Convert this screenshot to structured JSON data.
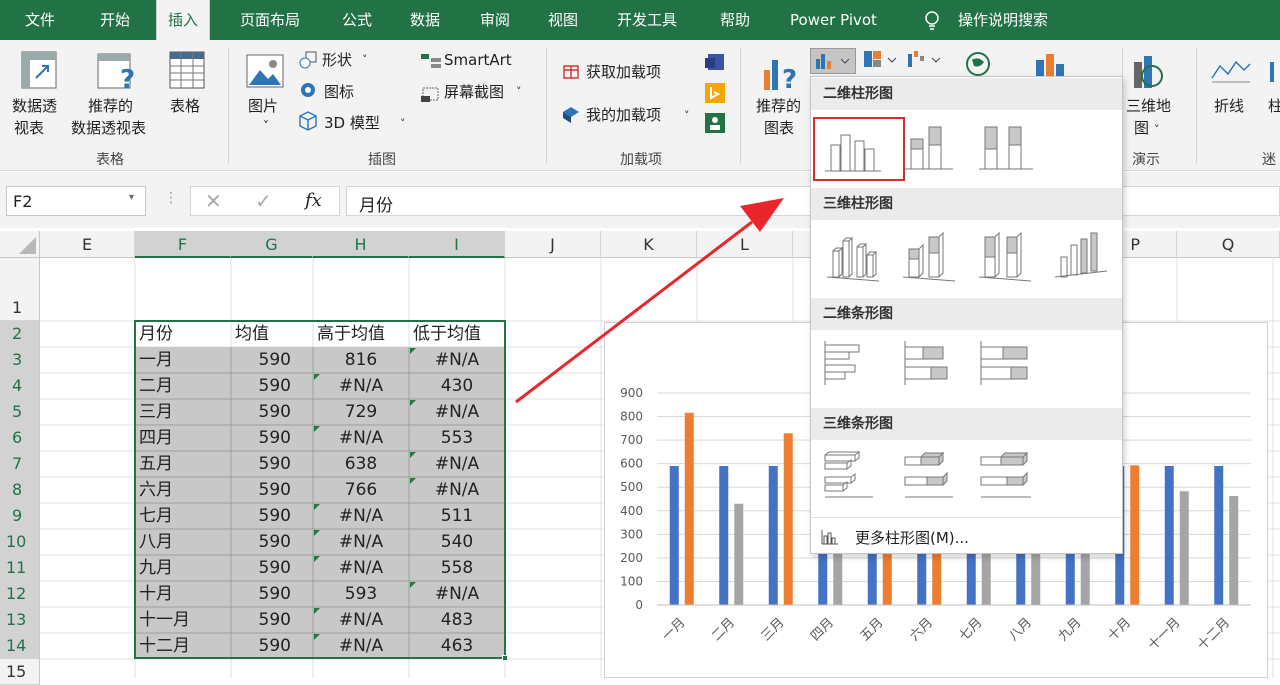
{
  "tabs": [
    "文件",
    "开始",
    "插入",
    "页面布局",
    "公式",
    "数据",
    "审阅",
    "视图",
    "开发工具",
    "帮助",
    "Power Pivot",
    "操作说明搜索"
  ],
  "ribbon": {
    "pivot": "数据透视表",
    "pivot_line1": "数据透",
    "pivot_line2": "视表",
    "recommended_pivot_1": "推荐的",
    "recommended_pivot_2": "数据透视表",
    "table": "表格",
    "picture": "图片",
    "shapes": "形状",
    "icons": "图标",
    "model3d": "3D 模型",
    "smartart": "SmartArt",
    "screenshot": "屏幕截图",
    "get_addins": "获取加载项",
    "my_addins": "我的加载项",
    "rec_chart_1": "推荐的",
    "rec_chart_2": "图表",
    "map3d_1": "三维地",
    "map3d_2": "图",
    "line": "折线",
    "col": "柱",
    "groups": {
      "tables": "表格",
      "illustrations": "插图",
      "addins": "加载项",
      "tours": "演示",
      "spark": "迷"
    }
  },
  "formula": {
    "name_box": "F2",
    "content": "月份"
  },
  "columns": [
    "E",
    "F",
    "G",
    "H",
    "I",
    "J",
    "K",
    "L",
    "P",
    "Q"
  ],
  "rows": [
    "1",
    "2",
    "3",
    "4",
    "5",
    "6",
    "7",
    "8",
    "9",
    "10",
    "11",
    "12",
    "13",
    "14",
    "15"
  ],
  "table": {
    "headers": [
      "月份",
      "均值",
      "高于均值",
      "低于均值"
    ],
    "rows": [
      [
        "一月",
        "590",
        "816",
        "#N/A"
      ],
      [
        "二月",
        "590",
        "#N/A",
        "430"
      ],
      [
        "三月",
        "590",
        "729",
        "#N/A"
      ],
      [
        "四月",
        "590",
        "#N/A",
        "553"
      ],
      [
        "五月",
        "590",
        "638",
        "#N/A"
      ],
      [
        "六月",
        "590",
        "766",
        "#N/A"
      ],
      [
        "七月",
        "590",
        "#N/A",
        "511"
      ],
      [
        "八月",
        "590",
        "#N/A",
        "540"
      ],
      [
        "九月",
        "590",
        "#N/A",
        "558"
      ],
      [
        "十月",
        "590",
        "593",
        "#N/A"
      ],
      [
        "十一月",
        "590",
        "#N/A",
        "483"
      ],
      [
        "十二月",
        "590",
        "#N/A",
        "463"
      ]
    ]
  },
  "menu": {
    "h1": "二维柱形图",
    "h2": "三维柱形图",
    "h3": "二维条形图",
    "h4": "三维条形图",
    "more": "更多柱形图(M)..."
  },
  "colors": {
    "excel_green": "#217346",
    "avg": "#4472c4",
    "above": "#ed7d31",
    "below": "#a5a5a5",
    "arrow": "#e8262b"
  },
  "chart_data": {
    "type": "bar",
    "categories": [
      "一月",
      "二月",
      "三月",
      "四月",
      "五月",
      "六月",
      "七月",
      "八月",
      "九月",
      "十月",
      "十一月",
      "十二月"
    ],
    "series": [
      {
        "values": [
          590,
          590,
          590,
          590,
          590,
          590,
          590,
          590,
          590,
          590,
          590,
          590
        ]
      },
      {
        "values": [
          816,
          null,
          729,
          null,
          638,
          766,
          null,
          null,
          null,
          593,
          null,
          null
        ]
      },
      {
        "values": [
          null,
          430,
          null,
          553,
          null,
          null,
          511,
          540,
          558,
          null,
          483,
          463
        ]
      }
    ],
    "yticks": [
      "0",
      "100",
      "200",
      "300",
      "400",
      "500",
      "600",
      "700",
      "800",
      "900"
    ],
    "ylim": [
      0,
      900
    ],
    "grid": true
  }
}
